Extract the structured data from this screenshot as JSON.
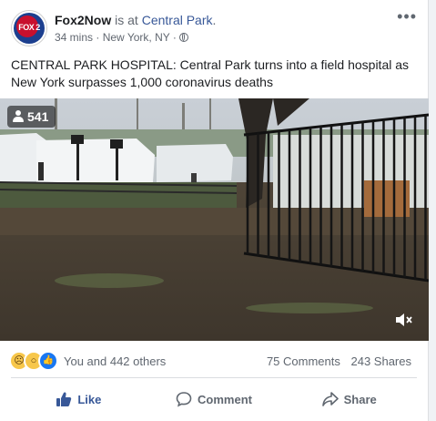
{
  "post": {
    "page_name": "Fox2Now",
    "is_at": " is at ",
    "place": "Central Park",
    "period": ".",
    "time": "34 mins",
    "location": "New York, NY",
    "separator": " · ",
    "avatar_text": "FOX 2",
    "more_label": "•••",
    "text": "CENTRAL PARK HOSPITAL: Central Park turns into a field hospital as New York surpasses 1,000 coronavirus deaths"
  },
  "video": {
    "viewer_count": "541"
  },
  "reactions": {
    "icons": [
      "sad-icon",
      "wow-icon",
      "like-icon"
    ],
    "text": "You and 442 others"
  },
  "stats": {
    "comments": "75 Comments",
    "shares": "243 Shares"
  },
  "actions": {
    "like": "Like",
    "comment": "Comment",
    "share": "Share"
  },
  "colors": {
    "like_blue": "#385898",
    "link_blue": "#385898",
    "secondary_text": "#606770"
  }
}
